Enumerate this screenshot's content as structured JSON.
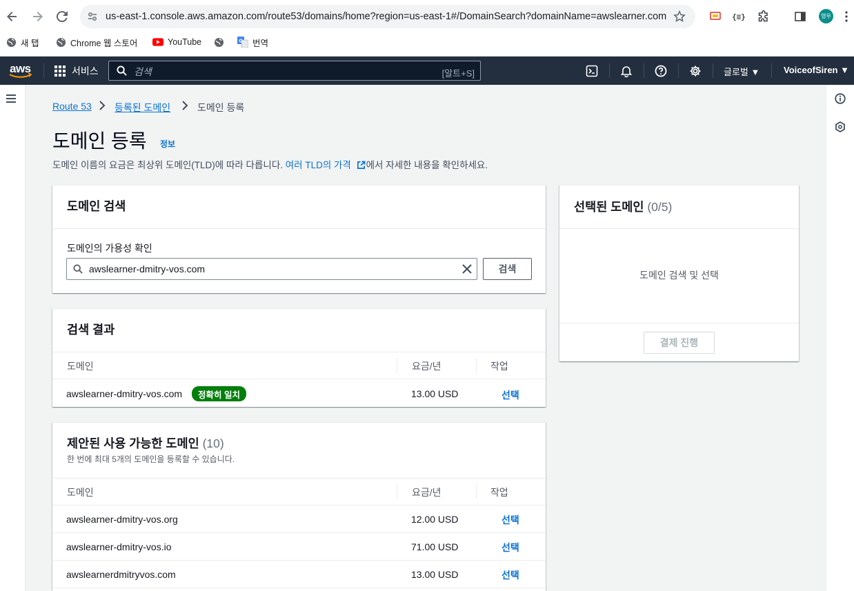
{
  "browser": {
    "url": "us-east-1.console.aws.amazon.com/route53/domains/home?region=us-east-1#/DomainSearch?domainName=awslearner.com",
    "profile_initials": "영우",
    "bookmarks": [
      {
        "label": "새 탭",
        "icon": "globe-icon"
      },
      {
        "label": "Chrome 웹 스토어",
        "icon": "globe-icon"
      },
      {
        "label": "YouTube",
        "icon": "youtube-icon"
      },
      {
        "label": "",
        "icon": "globe-icon"
      },
      {
        "label": "번역",
        "icon": "translate-icon"
      }
    ]
  },
  "aws_header": {
    "logo": "aws",
    "services_label": "서비스",
    "search_placeholder": "검색",
    "search_shortcut": "[알트+S]",
    "region_label": "글로벌 ▼",
    "account_label": "VoiceofSiren ▼",
    "colors": {
      "bar": "#232f3e",
      "accent": "#ff9900"
    }
  },
  "breadcrumb": {
    "items": [
      "Route 53",
      "등록된 도메인",
      "도메인 등록"
    ]
  },
  "page": {
    "title": "도메인 등록",
    "info_link": "정보",
    "description_before": "도메인 이름의 요금은 최상위 도메인(TLD)에 따라 다릅니다. ",
    "description_link": "여러 TLD의 가격",
    "description_after": "에서 자세한 내용을 확인하세요."
  },
  "domain_search": {
    "heading": "도메인 검색",
    "field_label": "도메인의 가용성 확인",
    "input_value": "awslearner-dmitry-vos.com",
    "search_button": "검색"
  },
  "results": {
    "heading": "검색 결과",
    "columns": [
      "도메인",
      "요금/년",
      "작업"
    ],
    "rows": [
      {
        "domain": "awslearner-dmitry-vos.com",
        "badge": "정확히 일치",
        "price": "13.00 USD",
        "action": "선택"
      }
    ]
  },
  "suggested": {
    "heading": "제안된 사용 가능한 도메인",
    "count": "(10)",
    "subtitle": "한 번에 최대 5개의 도메인을 등록할 수 있습니다.",
    "columns": [
      "도메인",
      "요금/년",
      "작업"
    ],
    "rows": [
      {
        "domain": "awslearner-dmitry-vos.org",
        "price": "12.00 USD",
        "action": "선택"
      },
      {
        "domain": "awslearner-dmitry-vos.io",
        "price": "71.00 USD",
        "action": "선택"
      },
      {
        "domain": "awslearnerdmitryvos.com",
        "price": "13.00 USD",
        "action": "선택"
      }
    ]
  },
  "selected_domains": {
    "heading": "선택된 도메인",
    "count": "(0/5)",
    "empty_text": "도메인 검색 및 선택",
    "checkout_button": "결제 진행"
  },
  "colors": {
    "link": "#0972d3",
    "success": "#037f0c",
    "page_bg": "#f2f3f3"
  }
}
